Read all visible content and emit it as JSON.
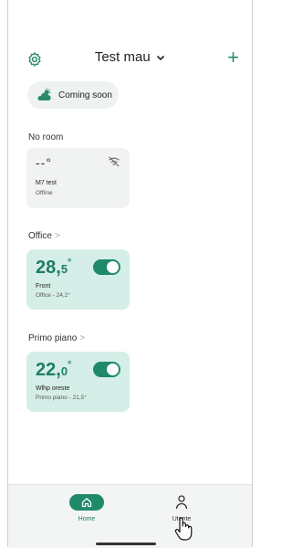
{
  "header": {
    "title": "Test mau",
    "settings_icon": "gear-icon",
    "add_icon": "plus-icon",
    "add_label": "+"
  },
  "weather": {
    "label": "Coming soon",
    "icon": "partly-sunny-icon"
  },
  "sections": [
    {
      "name": "No room",
      "has_arrow": false
    },
    {
      "name": "Office",
      "has_arrow": true
    },
    {
      "name": "Primo piano",
      "has_arrow": true
    }
  ],
  "arrow": ">",
  "devices": [
    {
      "temp": "--°",
      "name": "M7 test",
      "status": "Offline",
      "online": false
    },
    {
      "temp_int": "28,",
      "temp_dec": "5",
      "deg": "°",
      "name": "Front",
      "status": "Office - 24,2°",
      "online": true,
      "enabled": true
    },
    {
      "temp_int": "22,",
      "temp_dec": "0",
      "deg": "°",
      "name": "Wlhp oreste",
      "status": "Primo piano - 21,5°",
      "online": true,
      "enabled": true
    }
  ],
  "nav": {
    "home": {
      "label": "Home",
      "icon": "home-icon",
      "active": true
    },
    "user": {
      "label": "Utente",
      "icon": "user-icon",
      "active": false
    }
  },
  "colors": {
    "accent": "#1f8a6a",
    "card_on": "#d6eee8",
    "card_off": "#f1f3f2"
  }
}
